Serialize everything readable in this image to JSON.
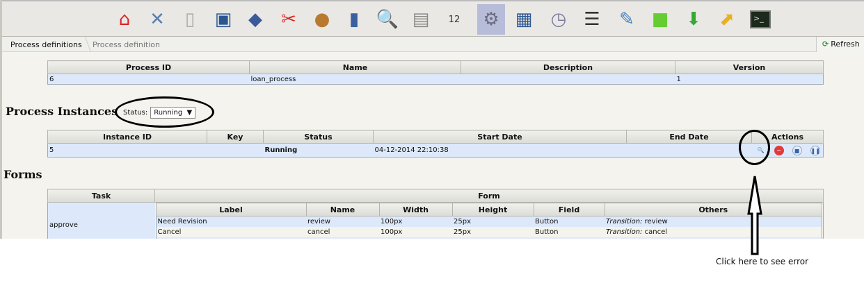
{
  "toolbar": {
    "icons": [
      "home-icon",
      "tools-icon",
      "document-wrench-icon",
      "monitor-icon",
      "diamond-map-icon",
      "scissors-ruler-icon",
      "users-icon",
      "shirt-tie-icon",
      "document-search-icon",
      "printer-icon",
      "calendar-icon",
      "gear-icon",
      "window-icon",
      "clock-icon",
      "list-icon",
      "pens-cup-icon",
      "flag-icon",
      "drive-download-icon",
      "drive-upload-icon",
      "terminal-icon"
    ],
    "calendar_day": "12"
  },
  "breadcrumb": {
    "items": [
      "Process definitions",
      "Process definition"
    ]
  },
  "refresh_label": "Refresh",
  "definition_table": {
    "headers": [
      "Process ID",
      "Name",
      "Description",
      "Version"
    ],
    "rows": [
      [
        "6",
        "loan_process",
        "",
        "1"
      ]
    ]
  },
  "instances": {
    "title": "Process Instances",
    "status_label": "Status:",
    "status_value": "Running",
    "headers": [
      "Instance ID",
      "Key",
      "Status",
      "Start Date",
      "End Date",
      "Actions"
    ],
    "rows": [
      [
        "5",
        "",
        "Running",
        "04-12-2014 22:10:38",
        ""
      ]
    ]
  },
  "forms": {
    "title": "Forms",
    "headers": [
      "Task",
      "Form"
    ],
    "task": "approve",
    "inner_headers": [
      "Label",
      "Name",
      "Width",
      "Height",
      "Field",
      "Others"
    ],
    "transition_label": "Transition:",
    "rows": [
      [
        "Need Revision",
        "review",
        "100px",
        "25px",
        "Button",
        "review"
      ],
      [
        "Cancel",
        "cancel",
        "100px",
        "25px",
        "Button",
        "cancel"
      ]
    ]
  },
  "annotation": "Click here to see error"
}
